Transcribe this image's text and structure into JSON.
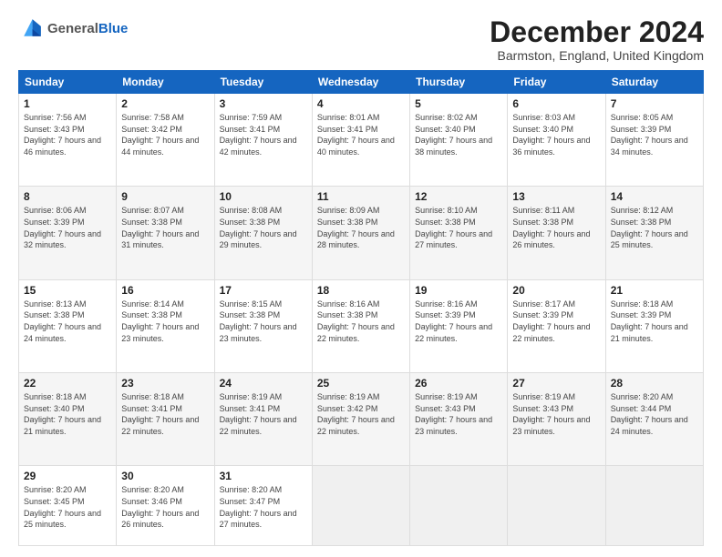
{
  "header": {
    "logo_general": "General",
    "logo_blue": "Blue",
    "month_title": "December 2024",
    "location": "Barmston, England, United Kingdom"
  },
  "weekdays": [
    "Sunday",
    "Monday",
    "Tuesday",
    "Wednesday",
    "Thursday",
    "Friday",
    "Saturday"
  ],
  "weeks": [
    [
      {
        "day": "1",
        "sunrise": "Sunrise: 7:56 AM",
        "sunset": "Sunset: 3:43 PM",
        "daylight": "Daylight: 7 hours and 46 minutes."
      },
      {
        "day": "2",
        "sunrise": "Sunrise: 7:58 AM",
        "sunset": "Sunset: 3:42 PM",
        "daylight": "Daylight: 7 hours and 44 minutes."
      },
      {
        "day": "3",
        "sunrise": "Sunrise: 7:59 AM",
        "sunset": "Sunset: 3:41 PM",
        "daylight": "Daylight: 7 hours and 42 minutes."
      },
      {
        "day": "4",
        "sunrise": "Sunrise: 8:01 AM",
        "sunset": "Sunset: 3:41 PM",
        "daylight": "Daylight: 7 hours and 40 minutes."
      },
      {
        "day": "5",
        "sunrise": "Sunrise: 8:02 AM",
        "sunset": "Sunset: 3:40 PM",
        "daylight": "Daylight: 7 hours and 38 minutes."
      },
      {
        "day": "6",
        "sunrise": "Sunrise: 8:03 AM",
        "sunset": "Sunset: 3:40 PM",
        "daylight": "Daylight: 7 hours and 36 minutes."
      },
      {
        "day": "7",
        "sunrise": "Sunrise: 8:05 AM",
        "sunset": "Sunset: 3:39 PM",
        "daylight": "Daylight: 7 hours and 34 minutes."
      }
    ],
    [
      {
        "day": "8",
        "sunrise": "Sunrise: 8:06 AM",
        "sunset": "Sunset: 3:39 PM",
        "daylight": "Daylight: 7 hours and 32 minutes."
      },
      {
        "day": "9",
        "sunrise": "Sunrise: 8:07 AM",
        "sunset": "Sunset: 3:38 PM",
        "daylight": "Daylight: 7 hours and 31 minutes."
      },
      {
        "day": "10",
        "sunrise": "Sunrise: 8:08 AM",
        "sunset": "Sunset: 3:38 PM",
        "daylight": "Daylight: 7 hours and 29 minutes."
      },
      {
        "day": "11",
        "sunrise": "Sunrise: 8:09 AM",
        "sunset": "Sunset: 3:38 PM",
        "daylight": "Daylight: 7 hours and 28 minutes."
      },
      {
        "day": "12",
        "sunrise": "Sunrise: 8:10 AM",
        "sunset": "Sunset: 3:38 PM",
        "daylight": "Daylight: 7 hours and 27 minutes."
      },
      {
        "day": "13",
        "sunrise": "Sunrise: 8:11 AM",
        "sunset": "Sunset: 3:38 PM",
        "daylight": "Daylight: 7 hours and 26 minutes."
      },
      {
        "day": "14",
        "sunrise": "Sunrise: 8:12 AM",
        "sunset": "Sunset: 3:38 PM",
        "daylight": "Daylight: 7 hours and 25 minutes."
      }
    ],
    [
      {
        "day": "15",
        "sunrise": "Sunrise: 8:13 AM",
        "sunset": "Sunset: 3:38 PM",
        "daylight": "Daylight: 7 hours and 24 minutes."
      },
      {
        "day": "16",
        "sunrise": "Sunrise: 8:14 AM",
        "sunset": "Sunset: 3:38 PM",
        "daylight": "Daylight: 7 hours and 23 minutes."
      },
      {
        "day": "17",
        "sunrise": "Sunrise: 8:15 AM",
        "sunset": "Sunset: 3:38 PM",
        "daylight": "Daylight: 7 hours and 23 minutes."
      },
      {
        "day": "18",
        "sunrise": "Sunrise: 8:16 AM",
        "sunset": "Sunset: 3:38 PM",
        "daylight": "Daylight: 7 hours and 22 minutes."
      },
      {
        "day": "19",
        "sunrise": "Sunrise: 8:16 AM",
        "sunset": "Sunset: 3:39 PM",
        "daylight": "Daylight: 7 hours and 22 minutes."
      },
      {
        "day": "20",
        "sunrise": "Sunrise: 8:17 AM",
        "sunset": "Sunset: 3:39 PM",
        "daylight": "Daylight: 7 hours and 22 minutes."
      },
      {
        "day": "21",
        "sunrise": "Sunrise: 8:18 AM",
        "sunset": "Sunset: 3:39 PM",
        "daylight": "Daylight: 7 hours and 21 minutes."
      }
    ],
    [
      {
        "day": "22",
        "sunrise": "Sunrise: 8:18 AM",
        "sunset": "Sunset: 3:40 PM",
        "daylight": "Daylight: 7 hours and 21 minutes."
      },
      {
        "day": "23",
        "sunrise": "Sunrise: 8:18 AM",
        "sunset": "Sunset: 3:41 PM",
        "daylight": "Daylight: 7 hours and 22 minutes."
      },
      {
        "day": "24",
        "sunrise": "Sunrise: 8:19 AM",
        "sunset": "Sunset: 3:41 PM",
        "daylight": "Daylight: 7 hours and 22 minutes."
      },
      {
        "day": "25",
        "sunrise": "Sunrise: 8:19 AM",
        "sunset": "Sunset: 3:42 PM",
        "daylight": "Daylight: 7 hours and 22 minutes."
      },
      {
        "day": "26",
        "sunrise": "Sunrise: 8:19 AM",
        "sunset": "Sunset: 3:43 PM",
        "daylight": "Daylight: 7 hours and 23 minutes."
      },
      {
        "day": "27",
        "sunrise": "Sunrise: 8:19 AM",
        "sunset": "Sunset: 3:43 PM",
        "daylight": "Daylight: 7 hours and 23 minutes."
      },
      {
        "day": "28",
        "sunrise": "Sunrise: 8:20 AM",
        "sunset": "Sunset: 3:44 PM",
        "daylight": "Daylight: 7 hours and 24 minutes."
      }
    ],
    [
      {
        "day": "29",
        "sunrise": "Sunrise: 8:20 AM",
        "sunset": "Sunset: 3:45 PM",
        "daylight": "Daylight: 7 hours and 25 minutes."
      },
      {
        "day": "30",
        "sunrise": "Sunrise: 8:20 AM",
        "sunset": "Sunset: 3:46 PM",
        "daylight": "Daylight: 7 hours and 26 minutes."
      },
      {
        "day": "31",
        "sunrise": "Sunrise: 8:20 AM",
        "sunset": "Sunset: 3:47 PM",
        "daylight": "Daylight: 7 hours and 27 minutes."
      },
      null,
      null,
      null,
      null
    ]
  ]
}
